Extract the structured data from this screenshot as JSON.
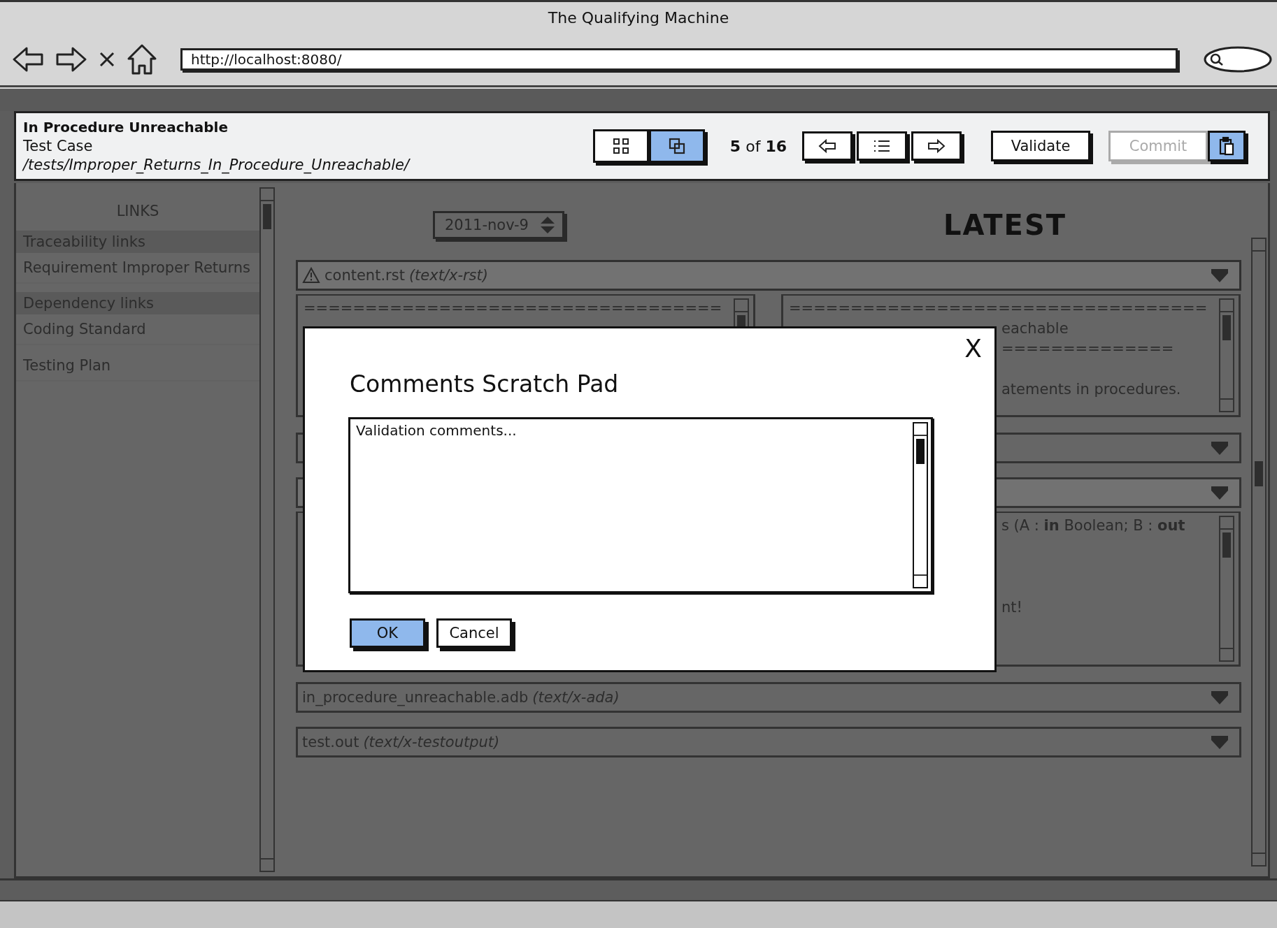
{
  "window": {
    "title": "The Qualifying Machine"
  },
  "address_bar": {
    "url": "http://localhost:8080/"
  },
  "header": {
    "title": "In Procedure Unreachable",
    "subtitle": "Test Case",
    "path": "/tests/Improper_Returns_In_Procedure_Unreachable/"
  },
  "view_toggle": [
    {
      "kind": "grid",
      "selected": false
    },
    {
      "kind": "overlap",
      "selected": true
    }
  ],
  "position": "**5** of **16**",
  "nav_buttons": [
    {
      "kind": "prev"
    },
    {
      "kind": "list"
    },
    {
      "kind": "next"
    }
  ],
  "actions": [
    {
      "label": "Validate",
      "disabled": false
    },
    {
      "label": "Commit",
      "disabled": true
    }
  ],
  "clipboard": {
    "pressed": true
  },
  "sidebar": {
    "title": "LINKS",
    "groups": [
      {
        "label": "Traceability links",
        "items": [
          "Requirement Improper Returns"
        ]
      },
      {
        "label": "Dependency links",
        "items": [
          "Coding Standard",
          "Testing Plan"
        ]
      }
    ]
  },
  "date_picker": {
    "value": "2011-nov-9"
  },
  "column_title": "LATEST",
  "files": [
    {
      "name": "content.rst",
      "type": "(text/x-rst)",
      "warning": true,
      "expanded": true,
      "left_lines": [
        {
          "text": "==================================",
          "kind": "whole"
        }
      ],
      "right_lines": [
        {
          "text": "==================================",
          "kind": "whole"
        },
        {
          "text": "eachable",
          "kind": "cut"
        },
        {
          "text": "==============",
          "kind": "cut"
        },
        {
          "text": "atements in procedures.",
          "kind": "cut-para"
        }
      ]
    },
    {
      "expanded": false
    },
    {
      "expanded": true,
      "right_lines": [
        {
          "text": "s (A : **in** Boolean; B : **out**",
          "kind": "cut"
        },
        {
          "text": "nt!",
          "kind": "cut-far"
        }
      ]
    },
    {
      "name": "in_procedure_unreachable.adb",
      "type": "(text/x-ada)",
      "warning": false,
      "expanded": false
    },
    {
      "name": "test.out",
      "type": "(text/x-testoutput)",
      "warning": false,
      "expanded": false
    }
  ],
  "dialog": {
    "title": "Comments Scratch Pad",
    "close": "X",
    "comment": {
      "placeholder": "Validation comments..."
    },
    "buttons": [
      {
        "label": "OK",
        "primary": true
      },
      {
        "label": "Cancel",
        "primary": false
      }
    ]
  }
}
